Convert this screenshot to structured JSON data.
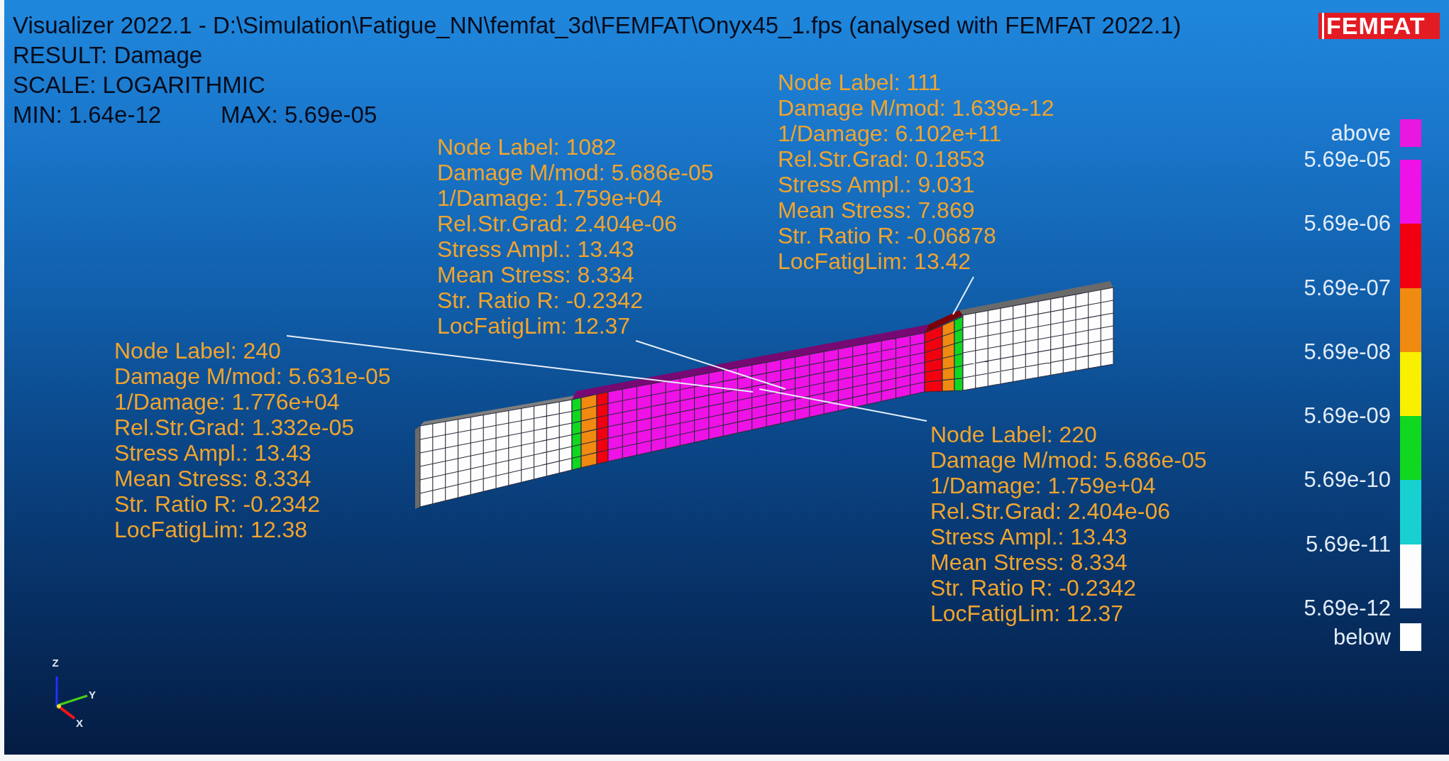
{
  "header": {
    "title": "Visualizer 2022.1 - D:\\Simulation\\Fatigue_NN\\femfat_3d\\FEMFAT\\Onyx45_1.fps (analysed with FEMFAT 2022.1)",
    "result": "RESULT: Damage",
    "scale": "SCALE: LOGARITHMIC",
    "min": "MIN: 1.64e-12",
    "max": "MAX: 5.69e-05"
  },
  "logo": {
    "text": "FEMFAT"
  },
  "annotations": [
    {
      "lines": [
        "Node Label: 111",
        "Damage M/mod: 1.639e-12",
        "1/Damage: 6.102e+11",
        "Rel.Str.Grad: 0.1853",
        "Stress Ampl.: 9.031",
        "Mean Stress: 7.869",
        "Str. Ratio R: -0.06878",
        "LocFatigLim: 13.42"
      ]
    },
    {
      "lines": [
        "Node Label: 1082",
        "Damage M/mod: 5.686e-05",
        "1/Damage: 1.759e+04",
        "Rel.Str.Grad: 2.404e-06",
        "Stress Ampl.: 13.43",
        "Mean Stress: 8.334",
        "Str. Ratio R: -0.2342",
        "LocFatigLim: 12.37"
      ]
    },
    {
      "lines": [
        "Node Label: 240",
        "Damage M/mod: 5.631e-05",
        "1/Damage: 1.776e+04",
        "Rel.Str.Grad: 1.332e-05",
        "Stress Ampl.: 13.43",
        "Mean Stress: 8.334",
        "Str. Ratio R: -0.2342",
        "LocFatigLim: 12.38"
      ]
    },
    {
      "lines": [
        "Node Label: 220",
        "Damage M/mod: 5.686e-05",
        "1/Damage: 1.759e+04",
        "Rel.Str.Grad: 2.404e-06",
        "Stress Ampl.: 13.43",
        "Mean Stress: 8.334",
        "Str. Ratio R: -0.2342",
        "LocFatigLim: 12.37"
      ]
    }
  ],
  "legend": {
    "above": {
      "label": "above",
      "color": "#e818e0"
    },
    "ticks": [
      "5.69e-05",
      "5.69e-06",
      "5.69e-07",
      "5.69e-08",
      "5.69e-09",
      "5.69e-10",
      "5.69e-11",
      "5.69e-12"
    ],
    "bands": [
      {
        "color": "#ee12e6"
      },
      {
        "color": "#f20010"
      },
      {
        "color": "#f08a10"
      },
      {
        "color": "#f8f000"
      },
      {
        "color": "#10d820"
      },
      {
        "color": "#18d0d0"
      },
      {
        "color": "#fdfdfd"
      }
    ],
    "below": {
      "label": "below",
      "color": "#ffffff"
    }
  },
  "triad": {
    "labels": [
      "Z",
      "Y",
      "X"
    ]
  }
}
